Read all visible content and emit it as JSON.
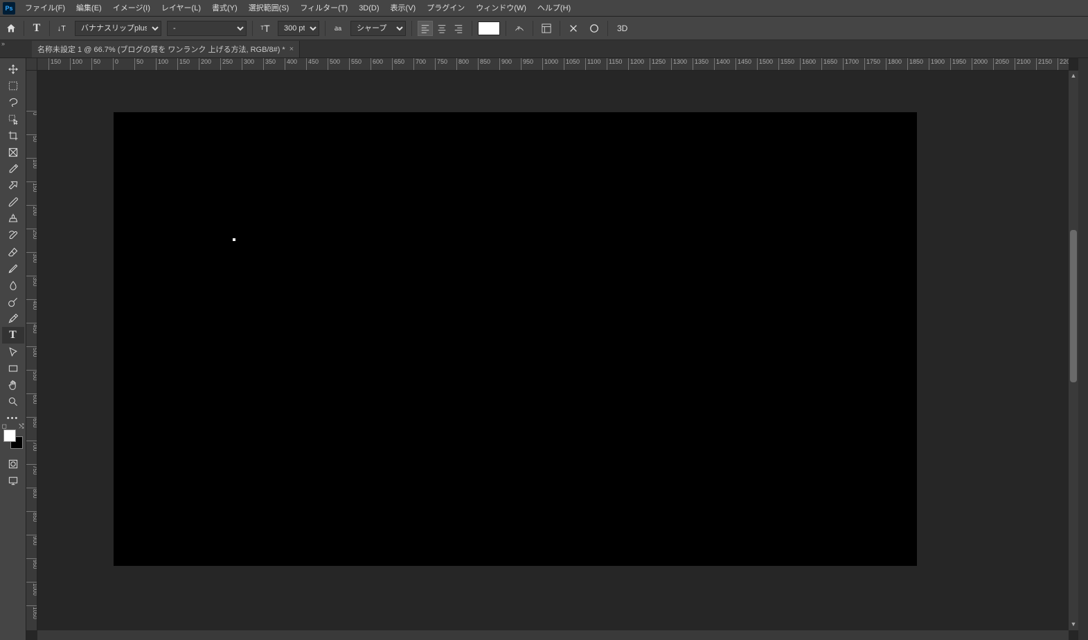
{
  "menu": {
    "logo": "Ps",
    "items": [
      "ファイル(F)",
      "編集(E)",
      "イメージ(I)",
      "レイヤー(L)",
      "書式(Y)",
      "選択範囲(S)",
      "フィルター(T)",
      "3D(D)",
      "表示(V)",
      "プラグイン",
      "ウィンドウ(W)",
      "ヘルプ(H)"
    ]
  },
  "options": {
    "font_family": "バナナスリップplus",
    "font_style": "-",
    "font_size": "300 pt",
    "aa_mode": "シャープ",
    "text_color": "#ffffff",
    "threeD": "3D"
  },
  "tab": {
    "title": "名称未設定 1 @ 66.7% (ブログの質を ワンランク 上げる方法, RGB/8#) *"
  },
  "ruler": {
    "h_start": -150,
    "h_step": 50,
    "h_count": 48,
    "v_start": 0,
    "v_step": 50,
    "v_count": 22
  },
  "tools": {
    "names": [
      "move",
      "marquee",
      "lasso",
      "object-select",
      "crop",
      "frame",
      "eyedropper",
      "healing",
      "brush",
      "clone",
      "history-brush",
      "eraser",
      "gradient",
      "blur",
      "dodge",
      "pen",
      "type",
      "path-select",
      "rectangle",
      "hand",
      "zoom",
      "more"
    ]
  },
  "colors": {
    "fg": "#ffffff",
    "bg": "#000000"
  }
}
